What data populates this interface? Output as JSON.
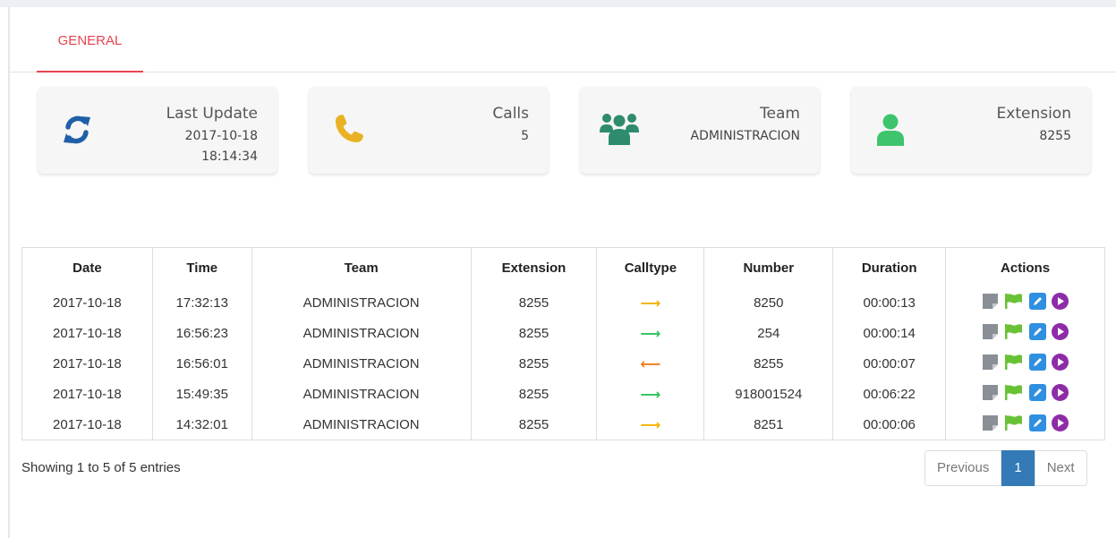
{
  "tabs": [
    {
      "label": "GENERAL"
    }
  ],
  "cards": {
    "last_update": {
      "title": "Last Update",
      "date": "2017-10-18",
      "time": "18:14:34"
    },
    "calls": {
      "title": "Calls",
      "value": "5"
    },
    "team": {
      "title": "Team",
      "value": "ADMINISTRACION"
    },
    "extension": {
      "title": "Extension",
      "value": "8255"
    }
  },
  "table": {
    "headers": [
      "Date",
      "Time",
      "Team",
      "Extension",
      "Calltype",
      "Number",
      "Duration",
      "Actions"
    ],
    "rows": [
      {
        "date": "2017-10-18",
        "time": "17:32:13",
        "team": "ADMINISTRACION",
        "extension": "8255",
        "calltype": "outgoing",
        "number": "8250",
        "duration": "00:00:13"
      },
      {
        "date": "2017-10-18",
        "time": "16:56:23",
        "team": "ADMINISTRACION",
        "extension": "8255",
        "calltype": "outgoing-answered",
        "number": "254",
        "duration": "00:00:14"
      },
      {
        "date": "2017-10-18",
        "time": "16:56:01",
        "team": "ADMINISTRACION",
        "extension": "8255",
        "calltype": "incoming",
        "number": "8255",
        "duration": "00:00:07"
      },
      {
        "date": "2017-10-18",
        "time": "15:49:35",
        "team": "ADMINISTRACION",
        "extension": "8255",
        "calltype": "outgoing-answered",
        "number": "918001524",
        "duration": "00:06:22"
      },
      {
        "date": "2017-10-18",
        "time": "14:32:01",
        "team": "ADMINISTRACION",
        "extension": "8255",
        "calltype": "outgoing",
        "number": "8251",
        "duration": "00:00:06"
      }
    ]
  },
  "calltype_styles": {
    "outgoing": {
      "glyph": "⟶",
      "color": "#f0b400"
    },
    "outgoing-answered": {
      "glyph": "⟶",
      "color": "#2ec25b"
    },
    "incoming": {
      "glyph": "⟵",
      "color": "#ee7d1c"
    }
  },
  "action_icons": [
    "note-icon",
    "flag-icon",
    "edit-icon",
    "play-icon"
  ],
  "footer": {
    "info": "Showing 1 to 5 of 5 entries"
  },
  "pagination": {
    "previous": "Previous",
    "current": "1",
    "next": "Next"
  },
  "colors": {
    "accent": "#e8434f",
    "refresh_icon": "#1f5fa8",
    "phone_icon": "#e9b224",
    "team_icon": "#2e8b6e",
    "user_icon": "#3ec46d",
    "page_active": "#337ab7",
    "note_icon": "#8a8f96",
    "flag_icon": "#69c236",
    "edit_icon": "#2f8fe0",
    "play_icon": "#8e2ca8"
  }
}
